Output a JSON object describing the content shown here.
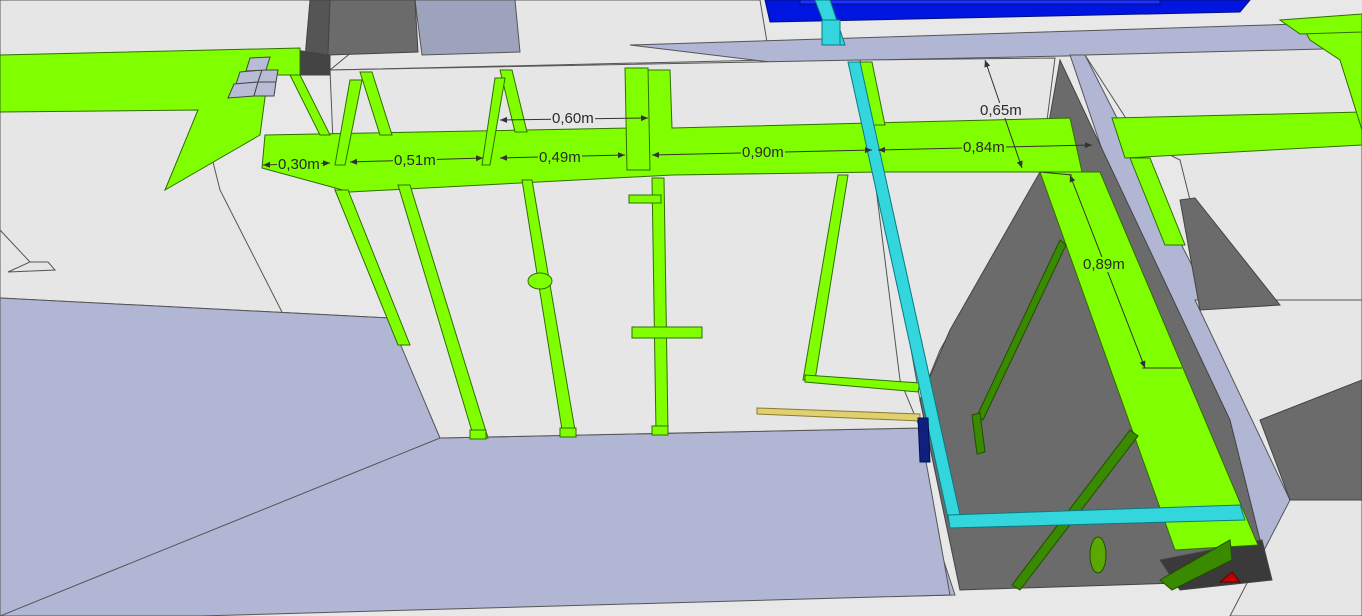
{
  "dimensions": [
    {
      "id": "d030",
      "text": "0,30m"
    },
    {
      "id": "d051",
      "text": "0,51m"
    },
    {
      "id": "d049",
      "text": "0,49m"
    },
    {
      "id": "d060",
      "text": "0,60m"
    },
    {
      "id": "d090",
      "text": "0,90m"
    },
    {
      "id": "d084",
      "text": "0,84m"
    },
    {
      "id": "d065",
      "text": "0,65m"
    },
    {
      "id": "d089",
      "text": "0,89m"
    }
  ],
  "colors": {
    "floor_light": "#e6e6e6",
    "floor_lavender": "#b0b6d4",
    "cavity_dark": "#6b6b6b",
    "pipe_green": "#80ff00",
    "pipe_dark_green": "#3a8a00",
    "pipe_cyan": "#33d6dd",
    "pipe_blue": "#0015e0",
    "pipe_yellow": "#e0d070",
    "marker_red": "#c00000",
    "dimension_line": "#333333"
  }
}
